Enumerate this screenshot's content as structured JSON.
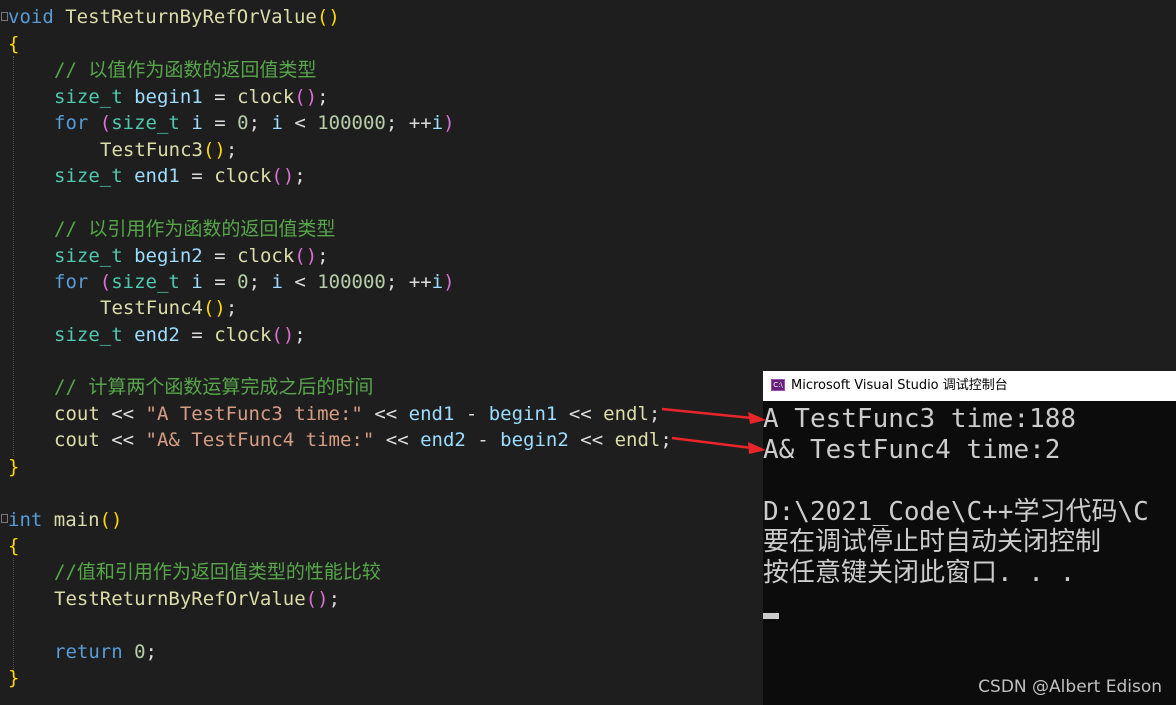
{
  "code": {
    "func_signature": {
      "ret": "void",
      "name": "TestReturnByRefOrValue",
      "lp": "(",
      "rp": ")"
    },
    "open_brace_1": "{",
    "comment_1": "// 以值作为函数的返回值类型",
    "begin1": {
      "type": "size_t",
      "name": "begin1",
      "op": " = ",
      "func": "clock",
      "lp": "(",
      "rp": ")",
      "semi": ";"
    },
    "for1": {
      "kw": "for",
      "lp": "(",
      "type": "size_t",
      "i": "i",
      "init": " = ",
      "zero": "0",
      "semi1": "; ",
      "i2": "i",
      "lt": " < ",
      "limit": "100000",
      "semi2": "; ",
      "inc": "++",
      "i3": "i",
      "rp": ")"
    },
    "call3": {
      "func": "TestFunc3",
      "lp": "(",
      "rp": ")",
      "semi": ";"
    },
    "end1": {
      "type": "size_t",
      "name": "end1",
      "op": " = ",
      "func": "clock",
      "lp": "(",
      "rp": ")",
      "semi": ";"
    },
    "comment_2": "// 以引用作为函数的返回值类型",
    "begin2": {
      "type": "size_t",
      "name": "begin2",
      "op": " = ",
      "func": "clock",
      "lp": "(",
      "rp": ")",
      "semi": ";"
    },
    "for2": {
      "kw": "for",
      "lp": "(",
      "type": "size_t",
      "i": "i",
      "init": " = ",
      "zero": "0",
      "semi1": "; ",
      "i2": "i",
      "lt": " < ",
      "limit": "100000",
      "semi2": "; ",
      "inc": "++",
      "i3": "i",
      "rp": ")"
    },
    "call4": {
      "func": "TestFunc4",
      "lp": "(",
      "rp": ")",
      "semi": ";"
    },
    "end2": {
      "type": "size_t",
      "name": "end2",
      "op": " = ",
      "func": "clock",
      "lp": "(",
      "rp": ")",
      "semi": ";"
    },
    "comment_3": "// 计算两个函数运算完成之后的时间",
    "cout1": {
      "obj": "cout",
      "op1": " << ",
      "str": "\"A TestFunc3 time:\"",
      "op2": " << ",
      "a": "end1",
      "minus": " - ",
      "b": "begin1",
      "op3": " << ",
      "endl": "endl",
      "semi": ";"
    },
    "cout2": {
      "obj": "cout",
      "op1": " << ",
      "str": "\"A& TestFunc4 time:\"",
      "op2": " << ",
      "a": "end2",
      "minus": " - ",
      "b": "begin2",
      "op3": " << ",
      "endl": "endl",
      "semi": ";"
    },
    "close_brace_1": "}",
    "main_signature": {
      "ret": "int",
      "name": "main",
      "lp": "(",
      "rp": ")"
    },
    "open_brace_2": "{",
    "comment_4": "//值和引用作为返回值类型的性能比较",
    "call_main": {
      "func": "TestReturnByRefOrValue",
      "lp": "(",
      "rp": ")",
      "semi": ";"
    },
    "return_stmt": {
      "kw": "return",
      "val": "0",
      "semi": ";"
    },
    "close_brace_2": "}"
  },
  "console": {
    "title": "Microsoft Visual Studio 调试控制台",
    "icon_label": "C:\\",
    "lines": [
      "A TestFunc3 time:188",
      "A& TestFunc4 time:2",
      "",
      "D:\\2021_Code\\C++学习代码\\C",
      "要在调试停止时自动关闭控制",
      "按任意键关闭此窗口. . ."
    ]
  },
  "watermark": "CSDN @Albert Edison",
  "colors": {
    "arrow": "#e8262a",
    "keyword": "#569cd6",
    "type": "#4ec9b0",
    "function": "#dcdcaa",
    "comment": "#57a64a",
    "string": "#d69d85"
  }
}
